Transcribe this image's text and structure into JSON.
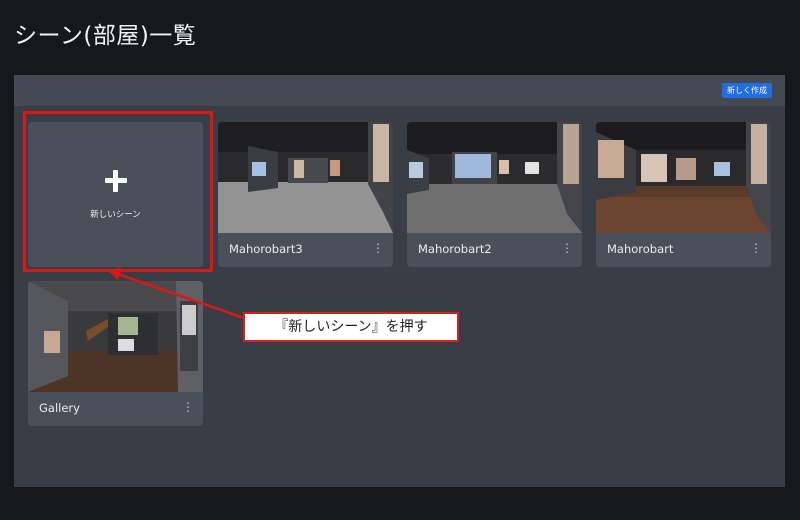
{
  "header": {
    "title": "シーン(部屋)一覧"
  },
  "toolbar": {
    "new_button_label": "新しく作成"
  },
  "new_scene_card": {
    "label": "新しいシーン",
    "icon": "plus-icon"
  },
  "scenes": [
    {
      "title": "Mahorobart3",
      "menu_icon": "more-vertical-icon"
    },
    {
      "title": "Mahorobart2",
      "menu_icon": "more-vertical-icon"
    },
    {
      "title": "Mahorobart",
      "menu_icon": "more-vertical-icon"
    },
    {
      "title": "Gallery",
      "menu_icon": "more-vertical-icon"
    }
  ],
  "annotation": {
    "callout_text": "『新しいシーン』を押す",
    "highlight_color": "#e01616"
  },
  "colors": {
    "background": "#17181c",
    "panel": "#393d45",
    "card": "#4a505a",
    "accent_button": "#1f6fde"
  }
}
